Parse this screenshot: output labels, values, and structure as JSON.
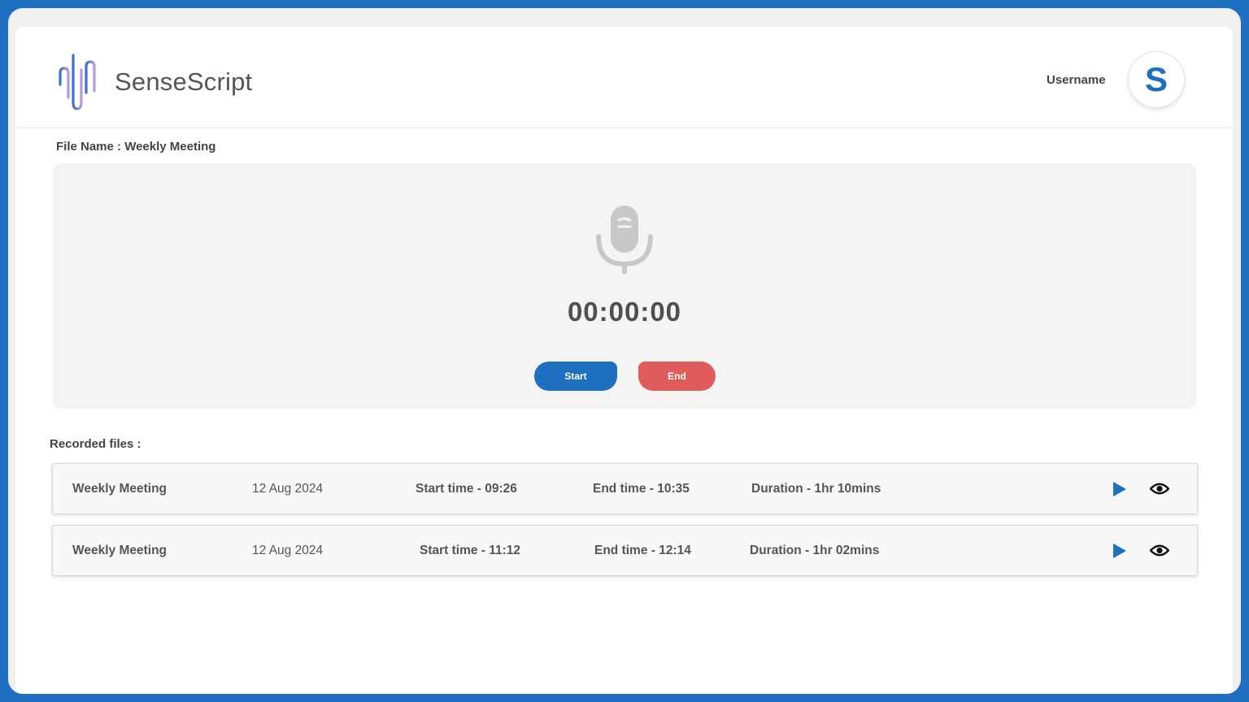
{
  "app": {
    "brand": "SenseScript",
    "username": "Username",
    "avatar_letter": "S"
  },
  "recorder": {
    "file_name_label": "File Name : Weekly Meeting",
    "timer": "00:00:00",
    "start_label": "Start",
    "end_label": "End"
  },
  "recorded": {
    "label": "Recorded files :",
    "rows": [
      {
        "name": "Weekly Meeting",
        "date": "12 Aug 2024",
        "start": "Start time - 09:26",
        "end": "End time - 10:35",
        "duration": "Duration - 1hr 10mins"
      },
      {
        "name": "Weekly Meeting",
        "date": "12 Aug 2024",
        "start": "Start time - 11:12",
        "end": "End time - 12:14",
        "duration": "Duration - 1hr 02mins"
      }
    ]
  },
  "icons": [
    "soundwave-logo-icon",
    "microphone-icon",
    "play-icon",
    "eye-icon"
  ],
  "colors": {
    "accent": "#1e6fbf",
    "end_button": "#e05c5c",
    "logo_gradient_start": "#3b6fd0",
    "logo_gradient_end": "#b99be6"
  }
}
